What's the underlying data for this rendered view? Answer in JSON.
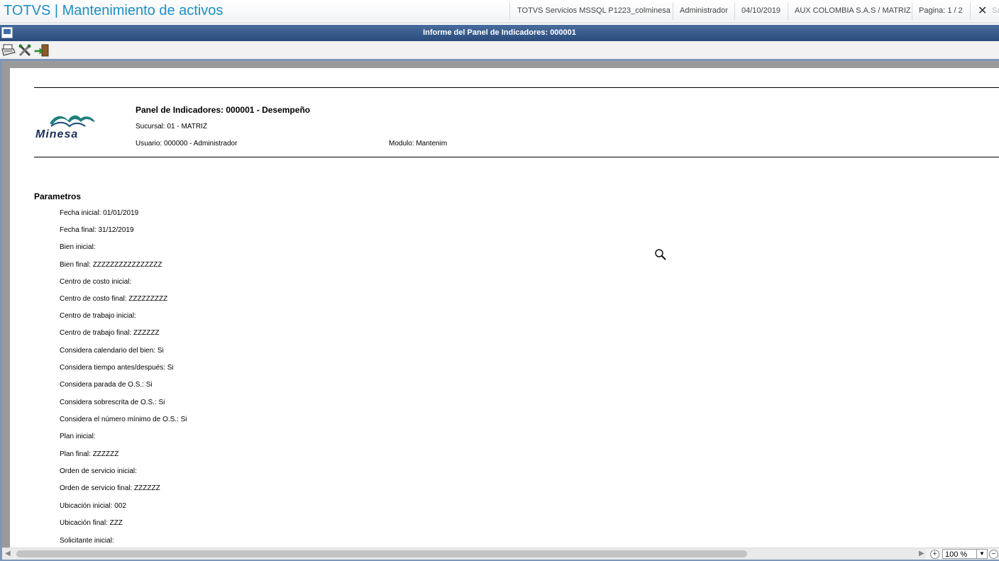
{
  "app": {
    "title": "TOTVS | Mantenimiento de activos"
  },
  "header": {
    "environment": "TOTVS Servicios MSSQL P1223_colminesa",
    "user": "Administrador",
    "date": "04/10/2019",
    "company": "AUX COLOMBIA S.A.S / MATRIZ",
    "page": "Pagina: 1 / 2",
    "cut_text": "Sa"
  },
  "dialog": {
    "title": "Informe del Panel de Indicadores: 000001"
  },
  "report": {
    "logo_text": "Minesa",
    "title": "Panel de Indicadores: 000001 - Desempeño",
    "branch": "Sucursal: 01 - MATRIZ",
    "user": "Usuario: 000000 - Administrador",
    "module": "Modulo: Mantenim",
    "params_title": "Parametros",
    "params": [
      "Fecha inicial: 01/01/2019",
      "Fecha final: 31/12/2019",
      "Bien inicial:",
      "Bien final: ZZZZZZZZZZZZZZZZ",
      "Centro de costo inicial:",
      "Centro de costo final: ZZZZZZZZZ",
      "Centro de trabajo inicial:",
      "Centro de trabajo final: ZZZZZZ",
      "Considera calendario del bien: Si",
      "Considera tiempo antes/después: Si",
      "Considera parada de O.S.: Si",
      "Considera sobrescrita de O.S.: Si",
      "Considera el número mínimo de O.S.: Si",
      "Plan inicial:",
      "Plan final: ZZZZZZ",
      "Orden de servicio inicial:",
      "Orden de servicio final: ZZZZZZ",
      "Ubicación inicial: 002",
      "Ubicación final: ZZZ",
      "Solicitante inicial:"
    ]
  },
  "zoom": {
    "value": "100 %"
  },
  "icons": {
    "dialog": "window-icon",
    "print": "printer-icon",
    "config": "tools-icon",
    "exit": "exit-door-icon",
    "cursor": "magnifier-icon",
    "close": "close-icon"
  },
  "colors": {
    "title_blue": "#1a8fc6",
    "dialog_bar": "#2a4b7c",
    "frame": "#7d96b8"
  }
}
